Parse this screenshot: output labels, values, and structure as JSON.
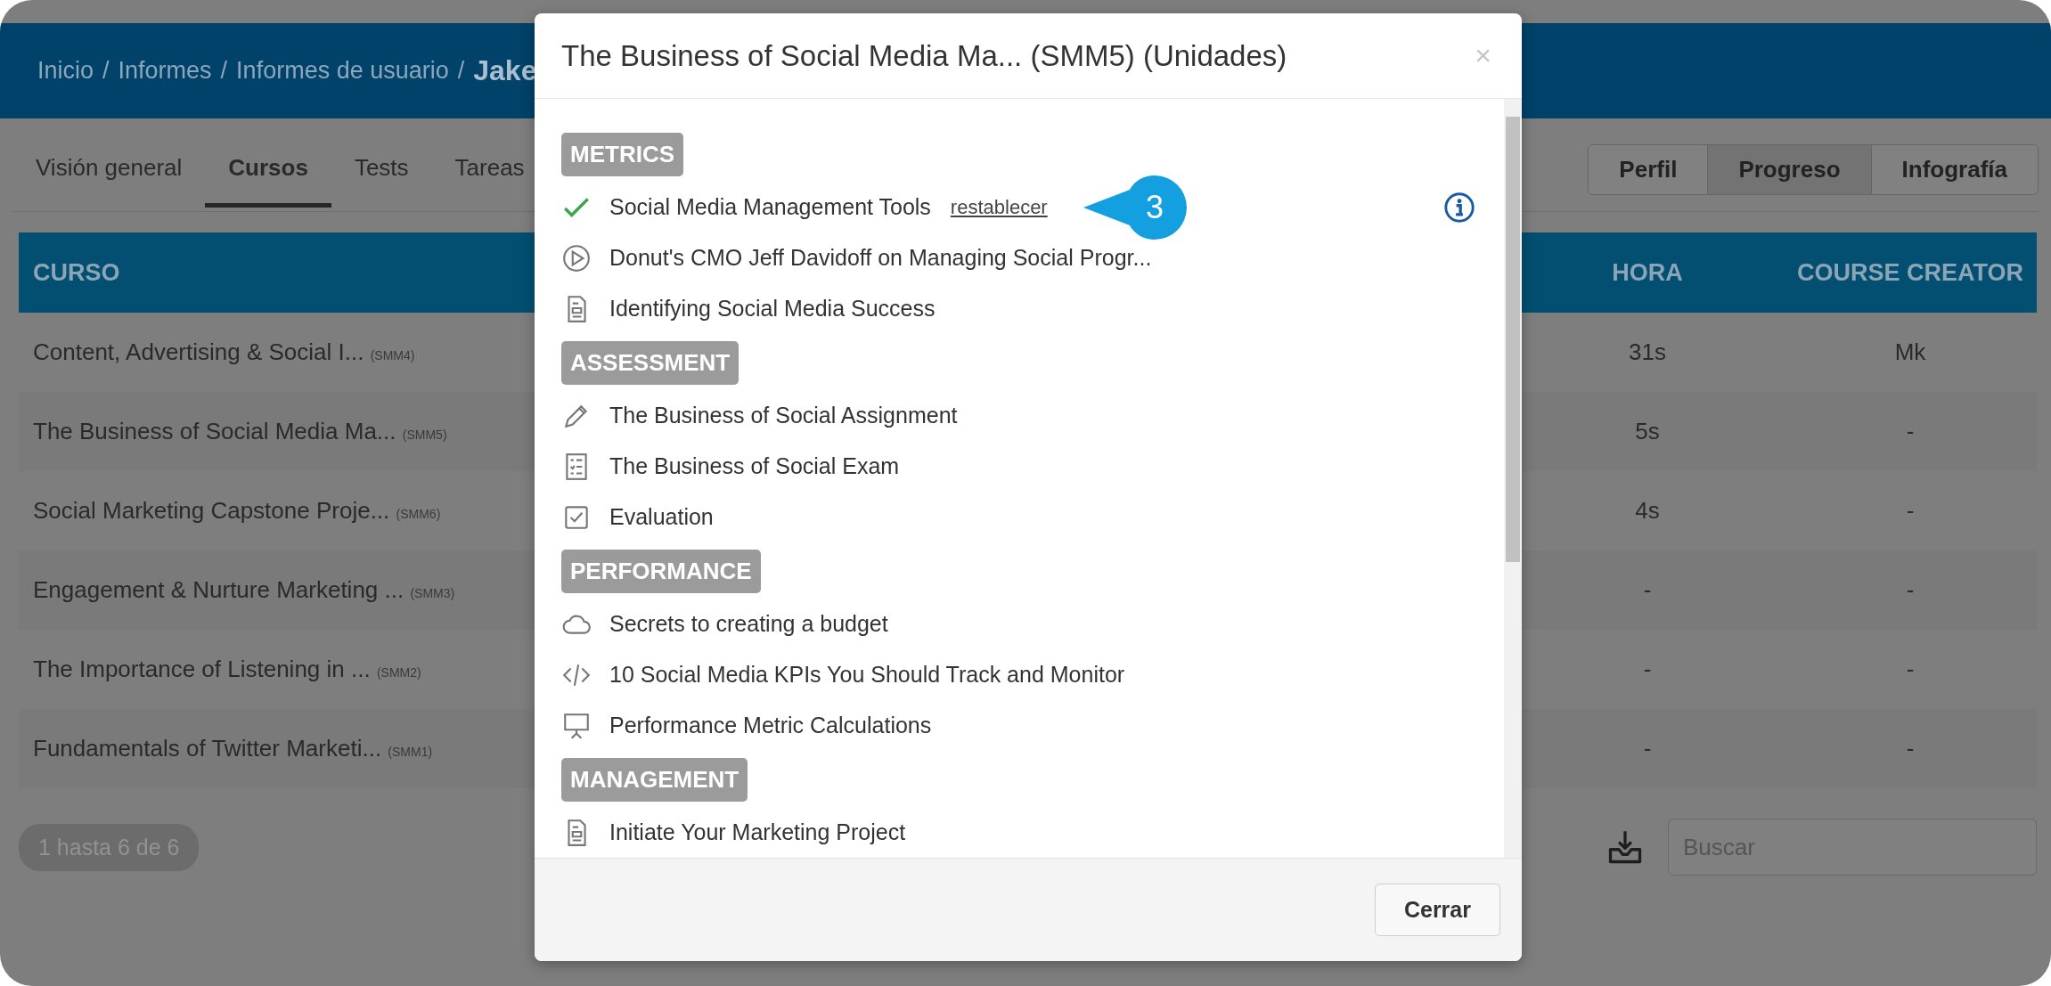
{
  "breadcrumb": {
    "separator": "/",
    "items": [
      "Inicio",
      "Informes",
      "Informes de usuario"
    ],
    "current": "Jake"
  },
  "tabs": [
    {
      "label": "Visión general",
      "selected": false
    },
    {
      "label": "Cursos",
      "selected": true
    },
    {
      "label": "Tests",
      "selected": false
    },
    {
      "label": "Tareas",
      "selected": false
    }
  ],
  "view_switch": [
    {
      "label": "Perfil",
      "selected": false
    },
    {
      "label": "Progreso",
      "selected": true
    },
    {
      "label": "Infografía",
      "selected": false
    }
  ],
  "table": {
    "columns": [
      "CURSO",
      "HORA",
      "COURSE CREATOR"
    ],
    "rows": [
      {
        "course": "Content, Advertising & Social I...",
        "code": "(SMM4)",
        "hora": "31s",
        "creator": "Mk"
      },
      {
        "course": "The Business of Social Media Ma...",
        "code": "(SMM5)",
        "hora": "5s",
        "creator": "-"
      },
      {
        "course": "Social Marketing Capstone Proje...",
        "code": "(SMM6)",
        "hora": "4s",
        "creator": "-"
      },
      {
        "course": "Engagement & Nurture Marketing ...",
        "code": "(SMM3)",
        "hora": "-",
        "creator": "-"
      },
      {
        "course": "The Importance of Listening in ...",
        "code": "(SMM2)",
        "hora": "-",
        "creator": "-"
      },
      {
        "course": "Fundamentals of Twitter Marketi...",
        "code": "(SMM1)",
        "hora": "-",
        "creator": "-"
      }
    ]
  },
  "pagination": "1 hasta 6 de 6",
  "search": {
    "placeholder": "Buscar"
  },
  "modal": {
    "title": "The Business of Social Media Ma... (SMM5) (Unidades)",
    "close": "×",
    "sections": [
      {
        "title": "METRICS",
        "items": [
          {
            "kind": "completed",
            "label": "Social Media Management Tools",
            "link": "restablecer",
            "callout": "3",
            "info": true
          },
          {
            "kind": "video",
            "label": "Donut's CMO Jeff Davidoff on Managing Social Progr..."
          },
          {
            "kind": "document",
            "label": "Identifying Social Media Success"
          }
        ]
      },
      {
        "title": "ASSESSMENT",
        "items": [
          {
            "kind": "assignment",
            "label": "The Business of Social Assignment"
          },
          {
            "kind": "exam",
            "label": "The Business of Social Exam"
          },
          {
            "kind": "survey",
            "label": "Evaluation"
          }
        ]
      },
      {
        "title": "PERFORMANCE",
        "items": [
          {
            "kind": "cloud",
            "label": "Secrets to creating a budget"
          },
          {
            "kind": "code",
            "label": "10 Social Media KPIs You Should Track and Monitor"
          },
          {
            "kind": "presentation",
            "label": "Performance Metric Calculations"
          }
        ]
      },
      {
        "title": "MANAGEMENT",
        "items": [
          {
            "kind": "document",
            "label": "Initiate Your Marketing Project"
          }
        ]
      }
    ],
    "button": "Cerrar"
  }
}
